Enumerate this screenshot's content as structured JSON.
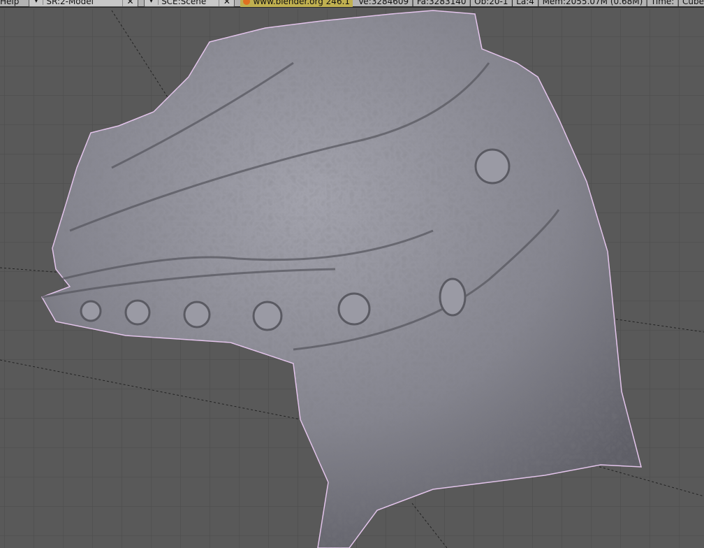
{
  "header": {
    "menu": "Help",
    "screen": "SR:2-Model",
    "scene": "SCE:Scene",
    "site": "www.blender.org 246.1",
    "stats": "Ve:3284609 | Fa:3283140 | Ob:20-1 | La:4 | Mem:2055.07M (0.68M) | Time: | Cube"
  },
  "viewport": {
    "background": "#595959",
    "grid": "#4c4c4c",
    "mesh": "#8a8a94",
    "outline": "#e8c8f0"
  }
}
